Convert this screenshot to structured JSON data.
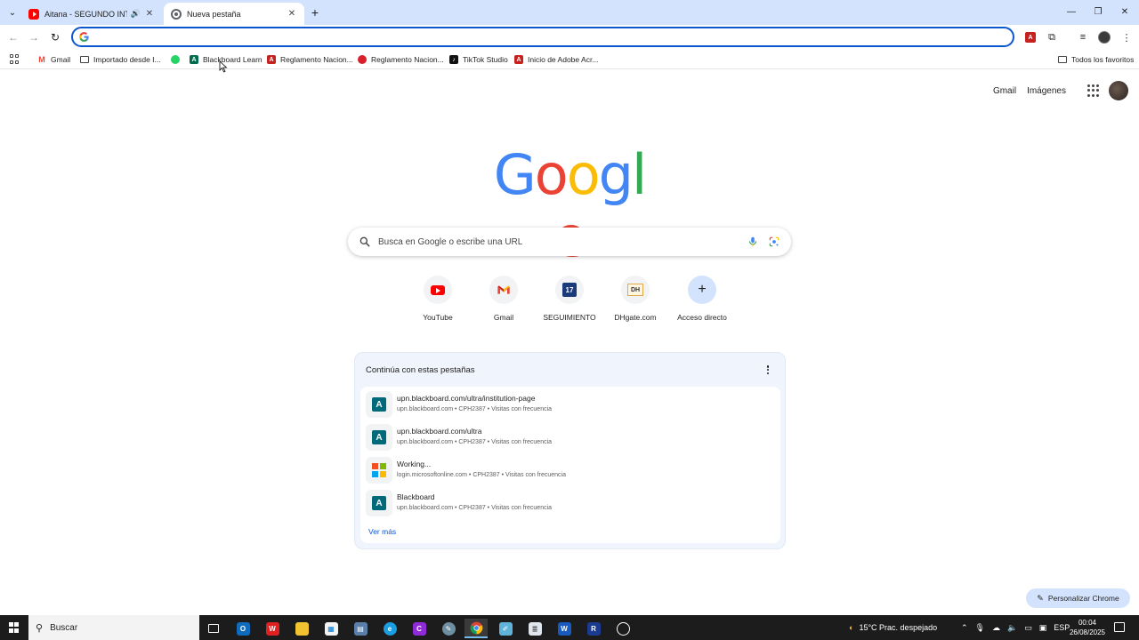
{
  "tabs": [
    {
      "title": "Aitana - SEGUNDO INTENTO",
      "active": false,
      "audio": true,
      "favicon": "youtube-icon"
    },
    {
      "title": "Nueva pestaña",
      "active": true,
      "audio": false,
      "favicon": "chrome-icon"
    }
  ],
  "omnibox": {
    "value": "",
    "placeholder": ""
  },
  "bookmarks": [
    {
      "label": "Gmail",
      "icon": "gmail-icon"
    },
    {
      "label": "Importado desde I...",
      "icon": "folder-icon"
    },
    {
      "label": "",
      "icon": "whatsapp-icon"
    },
    {
      "label": "Blackboard Learn",
      "icon": "blackboard-icon"
    },
    {
      "label": "Reglamento Nacion...",
      "icon": "pdf-icon"
    },
    {
      "label": "Reglamento Nacion...",
      "icon": "peru-icon"
    },
    {
      "label": "TikTok Studio",
      "icon": "tiktok-icon"
    },
    {
      "label": "Inicio de Adobe Acr...",
      "icon": "pdf-icon"
    }
  ],
  "all_bookmarks_label": "Todos los favoritos",
  "header_links": {
    "gmail": "Gmail",
    "images": "Imágenes"
  },
  "logo_letters": [
    "G",
    "o",
    "o",
    "g",
    "l",
    "e"
  ],
  "logo_colors": [
    "#4285f4",
    "#ea4335",
    "#fbbc05",
    "#4285f4",
    "#34a853",
    "#ea4335"
  ],
  "search": {
    "placeholder": "Busca en Google o escribe una URL"
  },
  "shortcuts": [
    {
      "label": "YouTube",
      "icon": "youtube-icon"
    },
    {
      "label": "Gmail",
      "icon": "gmail-icon"
    },
    {
      "label": "SEGUIMIENTO",
      "icon": "seguimiento-icon",
      "glyph": "17"
    },
    {
      "label": "DHgate.com",
      "icon": "dhgate-icon",
      "glyph": "DH"
    },
    {
      "label": "Acceso directo",
      "icon": "plus-icon"
    }
  ],
  "resume": {
    "heading": "Continúa con estas pestañas",
    "items": [
      {
        "title": "upn.blackboard.com/ultra/institution-page",
        "subtitle": "upn.blackboard.com • CPH2387 • Visitas con frecuencia",
        "icon": "blackboard-icon"
      },
      {
        "title": "upn.blackboard.com/ultra",
        "subtitle": "upn.blackboard.com • CPH2387 • Visitas con frecuencia",
        "icon": "blackboard-icon"
      },
      {
        "title": "Working...",
        "subtitle": "login.microsoftonline.com • CPH2387 • Visitas con frecuencia",
        "icon": "microsoft-icon"
      },
      {
        "title": "Blackboard",
        "subtitle": "upn.blackboard.com • CPH2387 • Visitas con frecuencia",
        "icon": "blackboard-icon"
      }
    ],
    "see_more": "Ver más"
  },
  "customize_label": "Personalizar Chrome",
  "taskbar": {
    "search_placeholder": "Buscar",
    "weather": "15°C  Prac. despejado",
    "language": "ESP",
    "time": "00:04",
    "date": "26/08/2025"
  },
  "colors": {
    "tabstrip": "#d3e3fd",
    "accent": "#0b57d0",
    "card_bg": "#f0f4fd",
    "taskbar": "#1c1c1c"
  }
}
